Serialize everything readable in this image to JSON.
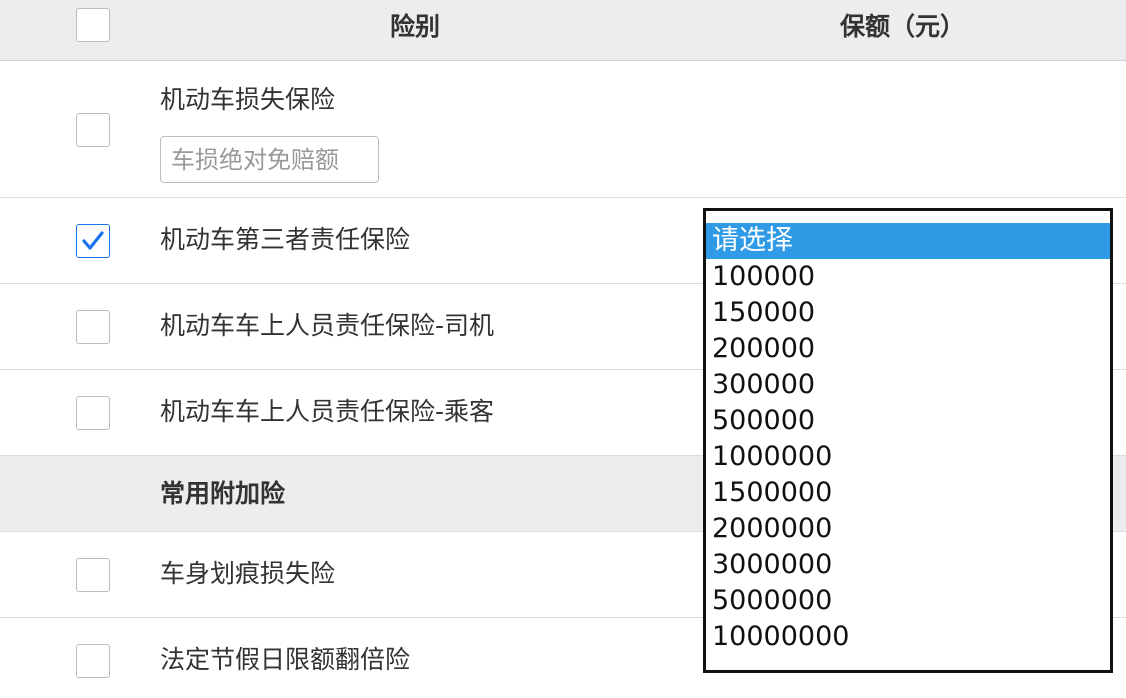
{
  "header": {
    "col_type": "险别",
    "col_amount": "保额（元）"
  },
  "rows": [
    {
      "label": "机动车损失保险",
      "checked": false,
      "deductible_placeholder": "车损绝对免赔额"
    },
    {
      "label": "机动车第三者责任保险",
      "checked": true
    },
    {
      "label": "机动车车上人员责任保险-司机",
      "checked": false
    },
    {
      "label": "机动车车上人员责任保险-乘客",
      "checked": false
    }
  ],
  "section": {
    "title": "常用附加险"
  },
  "addon_rows": [
    {
      "label": "车身划痕损失险",
      "checked": false
    },
    {
      "label": "法定节假日限额翻倍险",
      "checked": false
    }
  ],
  "amount_dropdown": {
    "selected": "请选择",
    "options": [
      "请选择",
      "100000",
      "150000",
      "200000",
      "300000",
      "500000",
      "1000000",
      "1500000",
      "2000000",
      "3000000",
      "5000000",
      "10000000"
    ]
  },
  "colors": {
    "header_bg": "#ecedef",
    "check_accent": "#1a73e8",
    "selected_option_bg": "#2f9ae6"
  },
  "icons": {
    "check": "checkmark-icon"
  }
}
